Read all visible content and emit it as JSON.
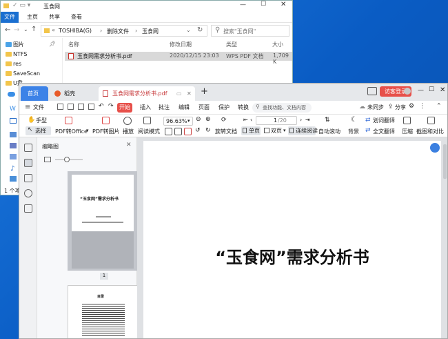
{
  "explorer": {
    "title": "玉食网",
    "ribbon_tabs": [
      "文件",
      "主页",
      "共享",
      "查看"
    ],
    "address": {
      "path": [
        "TOSHIBA(G)",
        "删除文件",
        "玉食网"
      ],
      "search_placeholder": "搜索\"玉食网\""
    },
    "nav_items": [
      {
        "label": "图片",
        "pinned": true
      },
      {
        "label": "NTFS"
      },
      {
        "label": "res"
      },
      {
        "label": "SaveScan"
      },
      {
        "label": "U盘"
      }
    ],
    "columns": [
      "名称",
      "修改日期",
      "类型",
      "大小"
    ],
    "files": [
      {
        "name": "玉食网需求分析书.pdf",
        "modified": "2020/12/15 23:03",
        "type": "WPS PDF 文档",
        "size": "1,709 K"
      }
    ],
    "status": "1 个项"
  },
  "wps": {
    "tabs": [
      {
        "label": "首页"
      },
      {
        "label": "稻壳"
      },
      {
        "label": "玉食网需求分析书.pdf",
        "active": true
      }
    ],
    "add_tab": "+",
    "login_label": "访客登录",
    "menu": {
      "file": "文件",
      "start": "开始",
      "items": [
        "插入",
        "批注",
        "编辑",
        "页面",
        "保护",
        "转换"
      ],
      "search_placeholder": "查找功能、文档内容",
      "unsynced": "未同步",
      "share": "分享"
    },
    "toolbar": {
      "hand": "手型",
      "select": "选择",
      "pdf_to_office": "PDF转Office",
      "pdf_to_image": "PDF转图片",
      "play": "播放",
      "read_mode": "阅读模式",
      "zoom": "96.63%",
      "rotate": "旋转文档",
      "single": "单页",
      "double": "双页",
      "continuous": "连续阅读",
      "auto_scroll": "自动滚动",
      "page_current": "1",
      "page_total": "/20",
      "background": "背景",
      "translate_words": "划词翻译",
      "translate_all": "全文翻译",
      "compress": "压缩",
      "screenshot": "截图和对比"
    },
    "thumbnails": {
      "title": "缩略图",
      "page_label": "1",
      "page1_title": "“玉食网”需求分析书",
      "page2_title": "目录"
    },
    "document": {
      "heading": "“玉食网”需求分析书"
    }
  }
}
